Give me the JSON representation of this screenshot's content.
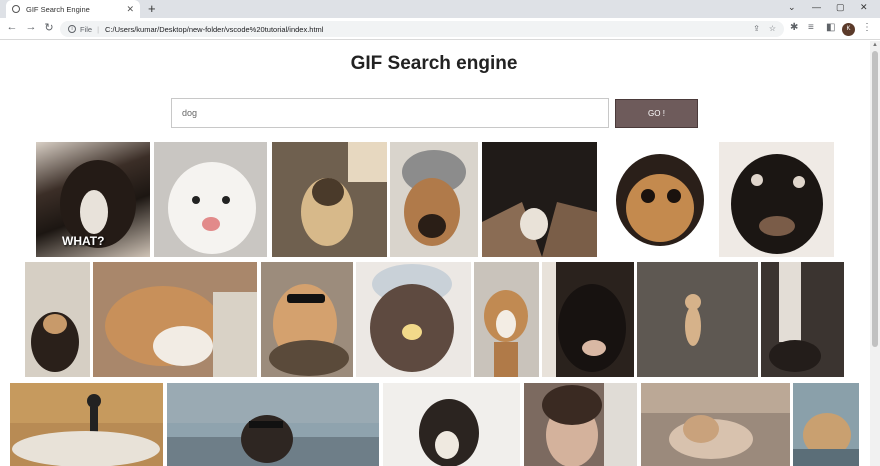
{
  "browser": {
    "tab_title": "GIF Search Engine",
    "new_tab": "+",
    "address_scheme": "File",
    "address_path": "C:/Users/kumar/Desktop/new-folder/vscode%20tutorial/index.html",
    "profile_initial": "K"
  },
  "page": {
    "heading": "GIF Search engine",
    "search_value": "dog",
    "go_label": "GO !",
    "gifs": [
      {
        "caption": "WHAT?"
      }
    ]
  }
}
